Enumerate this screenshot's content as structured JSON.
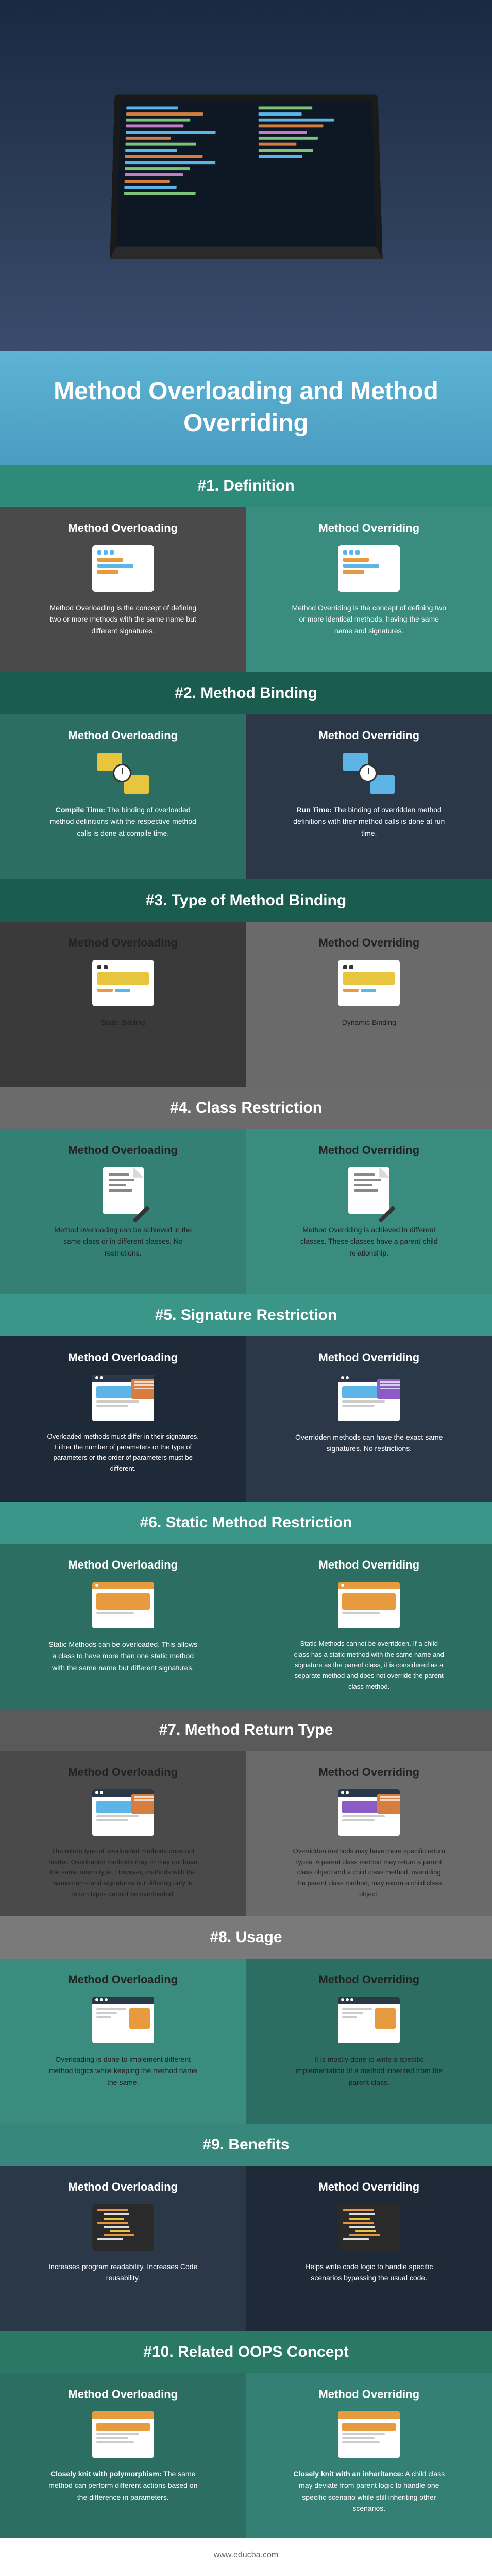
{
  "main_title": "Method Overloading and Method Overriding",
  "footer_url": "www.educba.com",
  "sections": [
    {
      "num": "#1.",
      "title": "Definition",
      "header_class": "sh-green",
      "left": {
        "bg": "col-gray",
        "heading": "Method Overloading",
        "text": "Method Overloading is the concept of defining two or more methods with the same name but different signatures."
      },
      "right": {
        "bg": "col-teal",
        "heading": "Method Overriding",
        "text": "Method Overriding is the concept of defining two or more identical methods, having the same name and signatures."
      }
    },
    {
      "num": "#2.",
      "title": "Method Binding",
      "header_class": "sh-darkgreen",
      "left": {
        "bg": "col-darkteal",
        "heading": "Method Overloading",
        "bold": "Compile Time:",
        "text": " The binding of overloaded method definitions with the respective method calls is done at compile time."
      },
      "right": {
        "bg": "col-navy",
        "heading": "Method Overriding",
        "bold": "Run Time:",
        "text": " The binding of overridden method definitions with their method calls is done at run time."
      }
    },
    {
      "num": "#3.",
      "title": "Type of Method Binding",
      "header_class": "sh-darkgreen",
      "left": {
        "bg": "col-dgray",
        "heading": "Method Overloading",
        "heading_dark": true,
        "text": "Static Binding"
      },
      "right": {
        "bg": "col-lightgray",
        "heading": "Method Overriding",
        "heading_dark": true,
        "text": "Dynamic Binding"
      }
    },
    {
      "num": "#4.",
      "title": "Class Restriction",
      "header_class": "sh-gray",
      "left": {
        "bg": "col-mteal",
        "heading": "Method Overloading",
        "heading_dark": true,
        "text": "Method overloading can be achieved in the same class or in different classes. No restrictions."
      },
      "right": {
        "bg": "col-teal",
        "heading": "Method Overriding",
        "heading_dark": true,
        "text": "Method Overriding is achieved in different classes. These classes have a parent-child relationship."
      }
    },
    {
      "num": "#5.",
      "title": "Signature Restriction",
      "header_class": "sh-teal",
      "left": {
        "bg": "col-darknavy",
        "heading": "Method Overloading",
        "text": "Overloaded methods must differ in their signatures. Either the number of parameters or the type of parameters or the order of parameters must be different."
      },
      "right": {
        "bg": "col-navy",
        "heading": "Method Overriding",
        "text": "Overridden methods can have the exact same signatures. No restrictions."
      }
    },
    {
      "num": "#6.",
      "title": "Static Method Restriction",
      "header_class": "sh-teal",
      "left": {
        "bg": "col-darkteal",
        "heading": "Method Overloading",
        "text": "Static Methods can be overloaded. This allows a class to have more than one static method with the same name but different signatures."
      },
      "right": {
        "bg": "col-darkteal",
        "heading": "Method Overriding",
        "text": "Static Methods cannot be overridden. If a child class has a static method with the same name and signature as the parent class, it is considered as a separate method and does not override the parent class method."
      }
    },
    {
      "num": "#7.",
      "title": "Method Return Type",
      "header_class": "sh-darkgray",
      "left": {
        "bg": "col-gray",
        "heading": "Method Overloading",
        "heading_dark": true,
        "text": "The return type of overloaded methods does not matter. Overloaded methods may or may not have the same return type. However, methods with the same name and signatures but differing only in return types cannot be overloaded."
      },
      "right": {
        "bg": "col-lightgray",
        "heading": "Method Overriding",
        "heading_dark": true,
        "text": "Overridden methods may have more specific return types. A parent class method may return a parent class object and a child class method, overriding the parent class method, may return a child class object."
      }
    },
    {
      "num": "#8.",
      "title": "Usage",
      "header_class": "sh-gray2",
      "left": {
        "bg": "col-teal",
        "heading": "Method Overloading",
        "heading_dark": true,
        "text": "Overloading is done to implement different method logics while keeping the method name the same."
      },
      "right": {
        "bg": "col-darkteal",
        "heading": "Method Overriding",
        "heading_dark": true,
        "text": "It is mostly done to write a specific implementation of a method inherited from the parent class."
      }
    },
    {
      "num": "#9.",
      "title": "Benefits",
      "header_class": "sh-teal2",
      "left": {
        "bg": "col-navy",
        "heading": "Method Overloading",
        "text": "Increases program readability. Increases Code reusability."
      },
      "right": {
        "bg": "col-darknavy",
        "heading": "Method Overriding",
        "text": "Helps write code logic to handle specific scenarios bypassing the usual code."
      }
    },
    {
      "num": "#10.",
      "title": "Related OOPS Concept",
      "header_class": "sh-greendark",
      "left": {
        "bg": "col-darkteal",
        "heading": "Method Overloading",
        "bold": "Closely knit with polymorphism:",
        "text": " The same method can perform different actions based on the difference in parameters."
      },
      "right": {
        "bg": "col-mteal",
        "heading": "Method Overriding",
        "bold": "Closely knit with an inheritance:",
        "text": " A child class may deviate from parent logic to handle one specific scenario while still inheriting other scenarios."
      }
    }
  ]
}
